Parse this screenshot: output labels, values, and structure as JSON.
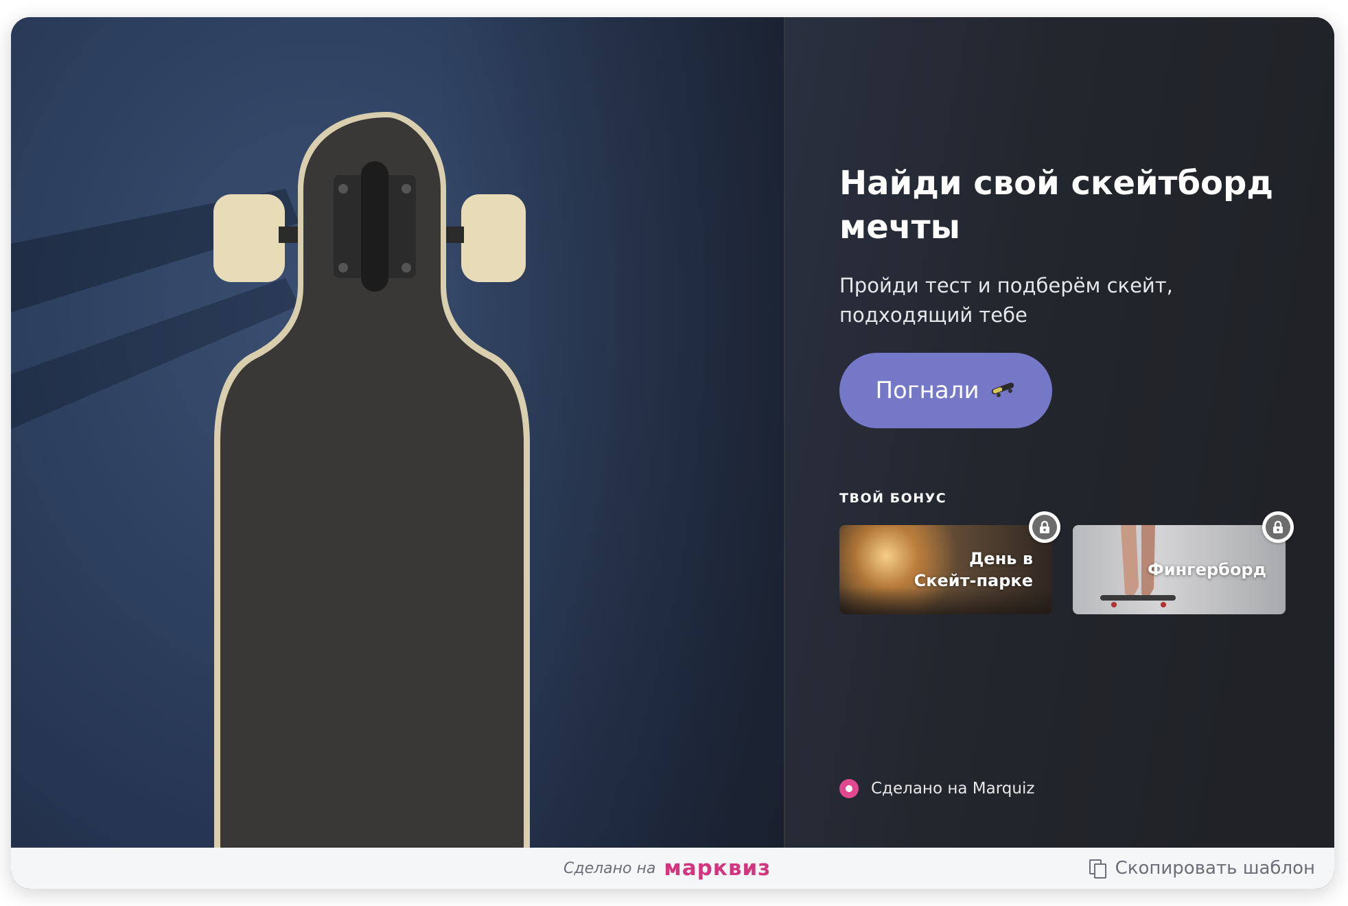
{
  "hero": {
    "title": "Найди свой скейтборд мечты",
    "subtitle": "Пройди тест и подберём скейт, подходящий тебе",
    "cta_label": "Погнали",
    "cta_icon": "skateboard-icon"
  },
  "bonus": {
    "label": "ТВОЙ БОНУС",
    "items": [
      {
        "label": "День в Скейт-парке",
        "icon": "lock-icon"
      },
      {
        "label": "Фингерборд",
        "icon": "lock-icon"
      }
    ]
  },
  "made_on": {
    "text": "Сделано на Marquiz"
  },
  "footer": {
    "made_text": "Сделано на",
    "brand": "марквиз",
    "copy_label": "Скопировать шаблон"
  },
  "colors": {
    "cta": "#7478c6",
    "brand": "#d4357f",
    "panel": "#1f2126"
  }
}
